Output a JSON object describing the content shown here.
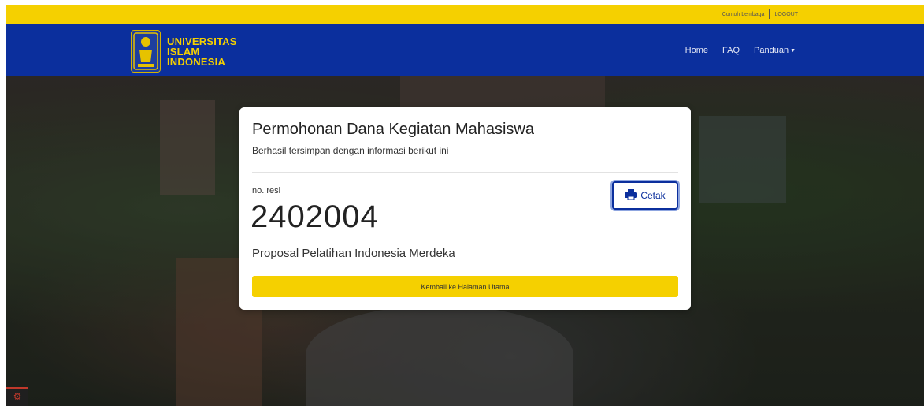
{
  "topbar": {
    "org_label": "Contoh Lembaga",
    "logout_label": "LOGOUT"
  },
  "brand": {
    "line1": "UNIVERSITAS",
    "line2": "ISLAM",
    "line3": "INDONESIA"
  },
  "nav": {
    "home": "Home",
    "faq": "FAQ",
    "panduan": "Panduan"
  },
  "card": {
    "title": "Permohonan Dana Kegiatan Mahasiswa",
    "subtitle": "Berhasil tersimpan dengan informasi berikut ini",
    "resi_label": "no. resi",
    "resi_number": "2402004",
    "proposal_name": "Proposal Pelatihan Indonesia Merdeka",
    "print_label": "Cetak",
    "back_label": "Kembali ke Halaman Utama"
  },
  "icons": {
    "print": "printer-icon",
    "caret": "caret-down-icon",
    "logo": "uii-logo",
    "corner": "laravel-icon"
  },
  "colors": {
    "topbar": "#f5d000",
    "navbar": "#0b2f9d",
    "brand_text": "#f5d000",
    "primary_button_border": "#0b2f9d",
    "back_button": "#f5d000"
  }
}
